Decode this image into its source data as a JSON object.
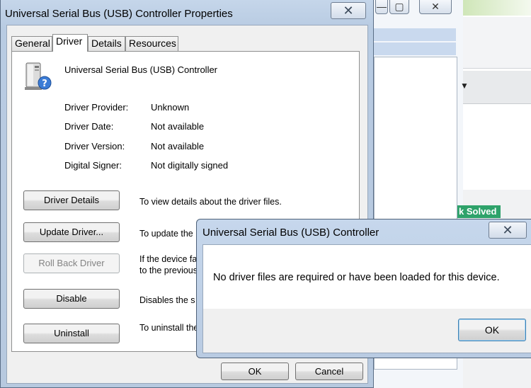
{
  "background": {
    "minimize_glyph": "—",
    "maximize_glyph": "▢",
    "close_glyph": "✕",
    "solved_badge": "k Solved",
    "arrow_glyph": "▼"
  },
  "dialog": {
    "title": "Universal Serial Bus (USB) Controller Properties",
    "close_glyph": "✕",
    "tabs": [
      {
        "label": "General"
      },
      {
        "label": "Driver"
      },
      {
        "label": "Details"
      },
      {
        "label": "Resources"
      }
    ],
    "device_icon": "usb-controller-unknown-icon",
    "device_name": "Universal Serial Bus (USB) Controller",
    "properties": [
      {
        "label": "Driver Provider:",
        "value": "Unknown"
      },
      {
        "label": "Driver Date:",
        "value": "Not available"
      },
      {
        "label": "Driver Version:",
        "value": "Not available"
      },
      {
        "label": "Digital Signer:",
        "value": "Not digitally signed"
      }
    ],
    "actions": [
      {
        "label": "Driver Details",
        "desc": "To view details about the driver files."
      },
      {
        "label": "Update Driver...",
        "desc": "To update the"
      },
      {
        "label": "Roll Back Driver",
        "desc": "If the device fa to the previous"
      },
      {
        "label": "Disable",
        "desc": "Disables the s"
      },
      {
        "label": "Uninstall",
        "desc": "To uninstall the"
      }
    ],
    "ok_label": "OK",
    "cancel_label": "Cancel"
  },
  "popup": {
    "title": "Universal Serial Bus (USB) Controller",
    "close_glyph": "✕",
    "message": "No driver files are required or have been loaded for this device.",
    "ok_label": "OK"
  }
}
